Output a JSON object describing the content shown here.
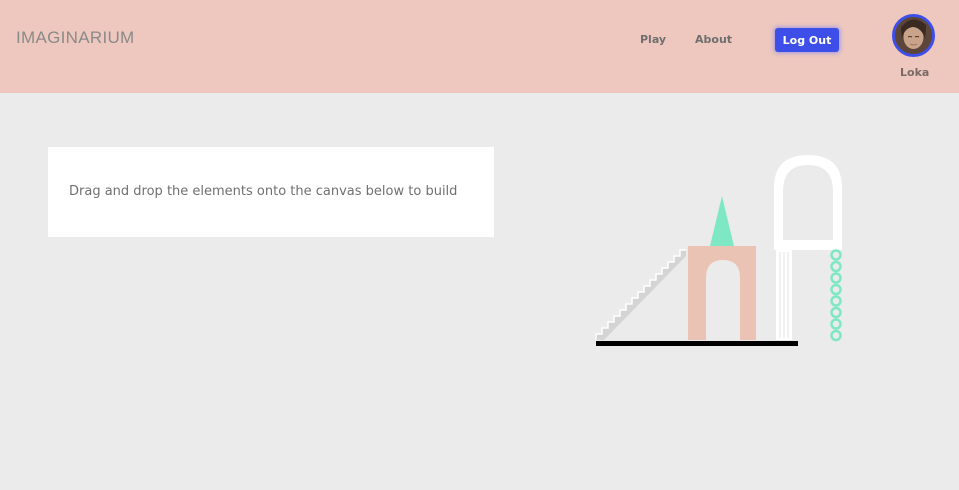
{
  "header": {
    "logo": "IMAGINARIUM",
    "nav": {
      "play": "Play",
      "about": "About"
    },
    "logout_label": "Log Out",
    "user": {
      "name": "Loka"
    }
  },
  "main": {
    "instruction": "Drag and drop the elements onto the canvas below to build"
  },
  "colors": {
    "header_bg": "#eec8be",
    "page_bg": "#ebebeb",
    "accent": "#3d4fe8",
    "arch_pink": "#ebc3b5",
    "mint": "#7ee8c4"
  },
  "illustration": {
    "elements": [
      "staircase",
      "pink-arch",
      "mint-cone",
      "white-arch-column",
      "mint-ring-chain",
      "ground-line"
    ]
  }
}
